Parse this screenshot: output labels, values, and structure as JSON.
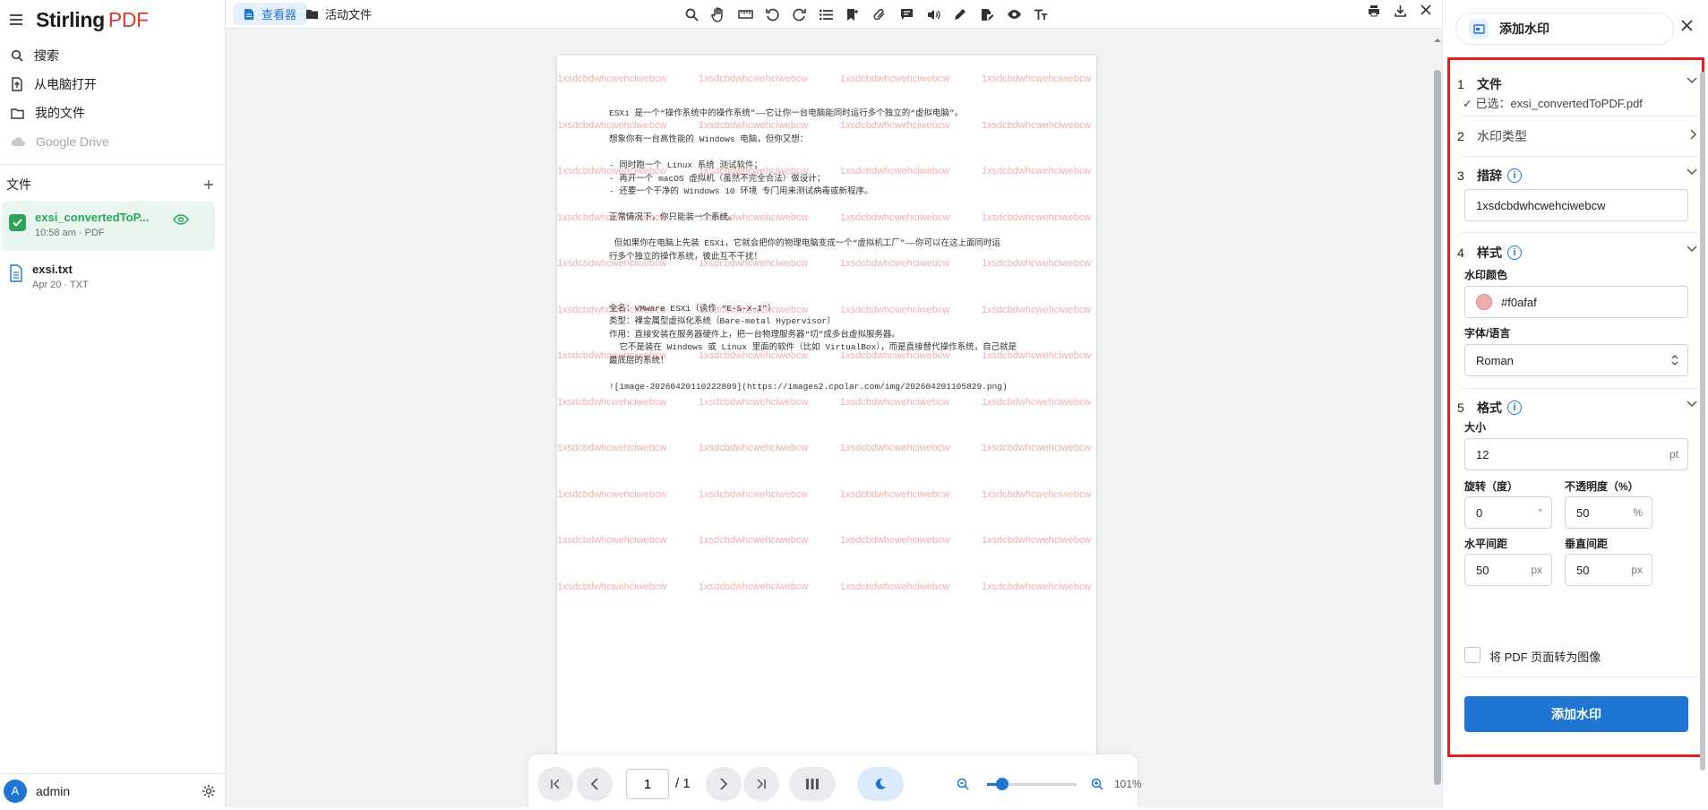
{
  "app": {
    "brand_main": "Stirling",
    "brand_accent": "PDF"
  },
  "sidebar": {
    "nav": [
      {
        "label": "搜索",
        "icon": "search-icon"
      },
      {
        "label": "从电脑打开",
        "icon": "upload-file-icon"
      },
      {
        "label": "我的文件",
        "icon": "folder-icon"
      },
      {
        "label": "Google Drive",
        "icon": "cloud-icon",
        "disabled": true
      }
    ],
    "files_header": "文件",
    "files": [
      {
        "name": "exsi_convertedToP...",
        "meta": "10:58 am · PDF",
        "selected": true
      },
      {
        "name": "exsi.txt",
        "meta": "Apr 20 · TXT",
        "selected": false
      }
    ],
    "user": {
      "initial": "A",
      "name": "admin"
    }
  },
  "viewer": {
    "tabs": [
      {
        "label": "查看器",
        "active": true
      },
      {
        "label": "活动文件",
        "active": false
      }
    ],
    "toolbar_icons": [
      "search-icon",
      "hand-icon",
      "ruler-icon",
      "rotate-left-icon",
      "rotate-right-icon",
      "list-icon",
      "bookmark-icon",
      "attachment-icon",
      "comment-icon",
      "audio-icon",
      "pen-icon",
      "file-sign-icon",
      "eye-icon",
      "text-format-icon"
    ],
    "page": {
      "watermark_text": "1xsdcbdwhcwehciwebcw",
      "lines": [
        "ESXi 是一个“操作系统中的操作系统”——它让你一台电脑能同时运行多个独立的“虚拟电脑”。",
        "",
        "想象你有一台高性能的 Windows 电脑，但你又想：",
        "",
        "- 同时跑一个 Linux 系统 测试软件；",
        "- 再开一个 macOS 虚拟机（虽然不完全合法）做设计；",
        "- 还要一个干净的 Windows 10 环境 专门用来测试病毒或新程序。",
        "",
        "正常情况下，你只能装一个系统。",
        "",
        " 但如果你在电脑上先装 ESXi，它就会把你的物理电脑变成一个“虚拟机工厂”——你可以在这上面同时运",
        "行多个独立的操作系统，彼此互不干扰！",
        "",
        "",
        "",
        "全名：VMware ESXi（读作 “E-S-X-I”）",
        "类型：裸金属型虚拟化系统（Bare-metal Hypervisor）",
        "作用：直接安装在服务器硬件上，把一台物理服务器“切”成多台虚拟服务器。",
        "  它不是装在 Windows 或 Linux 里面的软件（比如 VirtualBox），而是直接替代操作系统，自己就是",
        "最底层的系统！",
        "",
        "![image-20260420110222809](https://images2.cpolar.com/img/202604201105829.png)"
      ]
    },
    "pagination": {
      "current": "1",
      "total": "/ 1",
      "zoom": "101%",
      "zoom_level": 0.17
    }
  },
  "panel": {
    "title": "添加水印",
    "sections": [
      {
        "num": "1",
        "title": "文件",
        "sub": "✓ 已选：exsi_convertedToPDF.pdf"
      },
      {
        "num": "2",
        "title": "水印类型"
      },
      {
        "num": "3",
        "title": "措辞"
      },
      {
        "num": "4",
        "title": "样式"
      },
      {
        "num": "5",
        "title": "格式"
      }
    ],
    "text_value": "1xsdcbdwhcwehciwebcw",
    "color_label": "水印颜色",
    "color_value": "#f0afaf",
    "font_label": "字体/语言",
    "font_value": "Roman",
    "size_label": "大小",
    "size_value": "12",
    "size_unit": "pt",
    "rotation_label": "旋转（度）",
    "rotation_value": "0",
    "rotation_unit": "°",
    "opacity_label": "不透明度（%）",
    "opacity_value": "50",
    "opacity_unit": "%",
    "hspace_label": "水平间距",
    "hspace_value": "50",
    "vspace_label": "垂直间距",
    "vspace_value": "50",
    "px_unit": "px",
    "convert_label": "将 PDF 页面转为图像",
    "apply_label": "添加水印"
  },
  "colors": {
    "accent": "#1f76d2",
    "success": "#2aa55a",
    "highlight_border": "#e02020",
    "watermark": "#f0afaf"
  }
}
